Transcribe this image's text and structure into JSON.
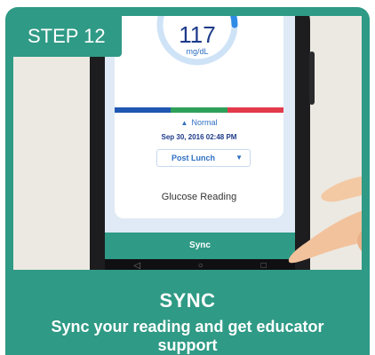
{
  "step": {
    "label": "STEP 12"
  },
  "screen": {
    "reading_value": "117",
    "reading_unit": "mg/dL",
    "status_text": "Normal",
    "timestamp": "Sep 30, 2016 02:48 PM",
    "meal_select": "Post Lunch",
    "card_label": "Glucose Reading",
    "sync_label": "Sync",
    "range_colors": [
      "#1f57b3",
      "#2fa05a",
      "#e23a4a"
    ]
  },
  "caption": {
    "title": "SYNC",
    "subtitle": "Sync your reading and get educator support"
  },
  "colors": {
    "brand_teal": "#2f9a85",
    "gauge_blue": "#2e8be6",
    "gauge_track": "#cfe3f7"
  },
  "icons": {
    "status": "triangle-up-icon",
    "select": "chevron-down-icon",
    "nav": [
      "back-icon",
      "home-icon",
      "recents-icon"
    ]
  }
}
